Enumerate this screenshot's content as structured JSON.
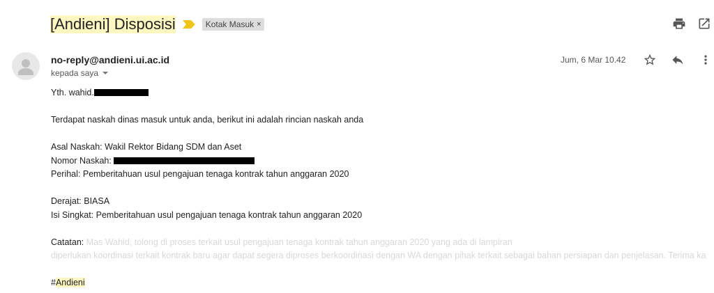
{
  "subject": {
    "prefix": "[Andieni] Disposisi"
  },
  "label_chip": {
    "text": "Kotak Masuk",
    "close": "×"
  },
  "icons": {
    "print": "print-icon",
    "open_new": "open-in-new-icon",
    "star": "star-icon",
    "reply": "reply-icon",
    "more": "more-vertical-icon",
    "importance": "importance-marker-icon",
    "avatar": "person-avatar-icon"
  },
  "colors": {
    "highlight": "#fff7c2",
    "importance": "#f0c419",
    "chip": "#dddddd"
  },
  "header": {
    "sender": "no-reply@andieni.ui.ac.id",
    "to": "kepada saya",
    "date": "Jum, 6 Mar 10.42"
  },
  "email": {
    "greeting": "Yth. wahid.",
    "intro": "Terdapat naskah dinas masuk untuk anda, berikut ini adalah rincian naskah anda",
    "asal": "Asal Naskah: Wakil Rektor Bidang SDM dan Aset",
    "nomor_label": "Nomor Naskah: ",
    "perihal": "Perihal: Pemberitahuan usul pengajuan tenaga kontrak tahun anggaran 2020",
    "derajat": "Derajat: BIASA",
    "isi": "Isi Singkat: Pemberitahuan usul pengajuan tenaga kontrak tahun anggaran 2020",
    "catatan_label": "Catatan: ",
    "catatan_line1": "Mas Wahid, tolong di proses terkait usul pengajuan tenaga kontrak tahun anggaran 2020 yang ada di lampiran",
    "catatan_line2": "diperlukan koordinasi terkait kontrak baru agar dapat segera diproses berkoordinasi dengan WA dengan pihak terkait sebagai bahan persiapan dan penjelasan. Terima kasih",
    "tag_hash": "#",
    "tag_name": "Andieni"
  }
}
